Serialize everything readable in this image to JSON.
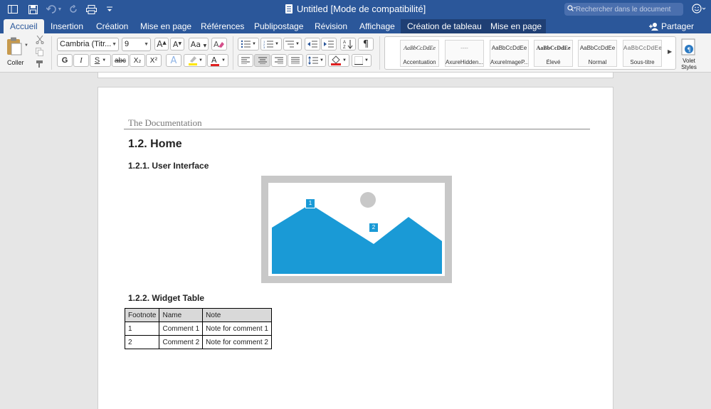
{
  "window": {
    "title": "Untitled [Mode de compatibilité]",
    "search_placeholder": "Rechercher dans le document"
  },
  "titlebar_icons": [
    "sidebar-icon",
    "save-icon",
    "undo-icon",
    "redo-icon",
    "print-icon",
    "customize-icon"
  ],
  "tabs": [
    {
      "label": "Accueil",
      "active": true
    },
    {
      "label": "Insertion"
    },
    {
      "label": "Création"
    },
    {
      "label": "Mise en page"
    },
    {
      "label": "Références"
    },
    {
      "label": "Publipostage"
    },
    {
      "label": "Révision"
    },
    {
      "label": "Affichage"
    },
    {
      "label": "Création de tableau",
      "contextual": true
    },
    {
      "label": "Mise en page",
      "contextual": true
    }
  ],
  "share_label": "Partager",
  "ribbon": {
    "paste_label": "Coller",
    "font_name": "Cambria (Titr...",
    "font_size": "9",
    "bold": "G",
    "italic": "I",
    "underline": "S",
    "strike": "abc",
    "subscript": "X₂",
    "superscript": "X²",
    "styles": [
      {
        "sample": "AaBbCcDdEe",
        "name": "Accentuation"
      },
      {
        "sample": "----",
        "name": "AxureHidden..."
      },
      {
        "sample": "AaBbCcDdEe",
        "name": "AxureImageP..."
      },
      {
        "sample": "AaBbCcDdEe",
        "name": "Élevé"
      },
      {
        "sample": "AaBbCcDdEe",
        "name": "Normal"
      },
      {
        "sample": "AaBbCcDdEe",
        "name": "Sous-titre"
      }
    ],
    "styles_pane_label": "Volet Styles"
  },
  "document": {
    "header": "The Documentation",
    "h1": "1.2. Home",
    "h2_ui": "1.2.1. User Interface",
    "image_markers": [
      "1",
      "2"
    ],
    "h2_table": "1.2.2. Widget Table",
    "table": {
      "headers": [
        "Footnote",
        "Name",
        "Note"
      ],
      "rows": [
        [
          "1",
          "Comment 1",
          "Note for comment 1"
        ],
        [
          "2",
          "Comment 2",
          "Note for comment 2"
        ]
      ]
    }
  },
  "colors": {
    "brand": "#2b579a",
    "image_fill": "#1a9ad6",
    "image_frame": "#c8c8c8"
  }
}
